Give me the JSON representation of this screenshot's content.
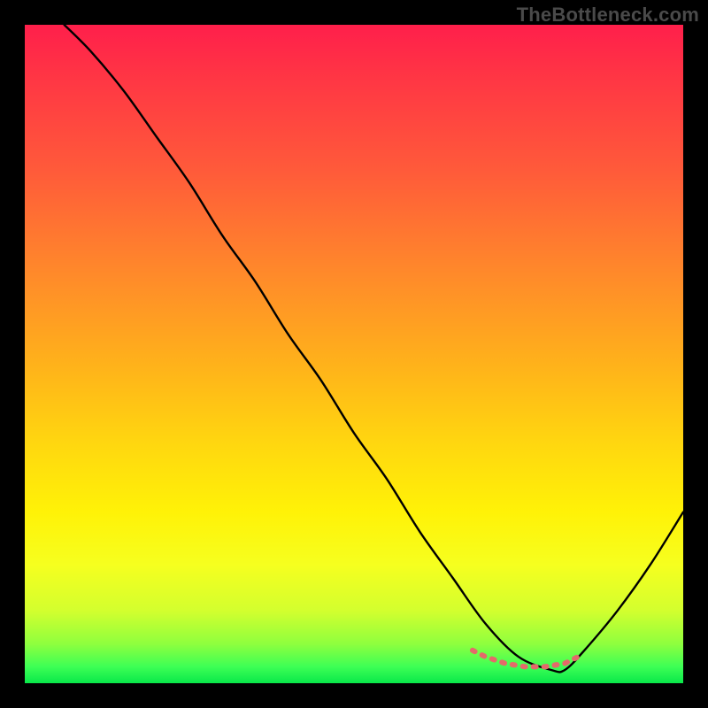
{
  "watermark": "TheBottleneck.com",
  "chart_data": {
    "type": "line",
    "title": "",
    "xlabel": "",
    "ylabel": "",
    "xlim": [
      0,
      100
    ],
    "ylim": [
      0,
      100
    ],
    "grid": false,
    "legend": false,
    "annotations": [],
    "notes": "Background is a vertical heat gradient (red at top through orange/yellow to green at bottom). A single black curve descends from top-left, reaches a flat trough near the bottom around x≈70–82, then rises toward the right. A short coral/dotted segment highlights the trough. Values estimated from pixel positions since no axes or ticks are drawn.",
    "series": [
      {
        "name": "main-curve",
        "color": "#000000",
        "x": [
          6,
          10,
          15,
          20,
          25,
          30,
          35,
          40,
          45,
          50,
          55,
          60,
          65,
          70,
          75,
          80,
          82,
          85,
          90,
          95,
          100
        ],
        "values": [
          100,
          96,
          90,
          83,
          76,
          68,
          61,
          53,
          46,
          38,
          31,
          23,
          16,
          9,
          4,
          2,
          2,
          5,
          11,
          18,
          26
        ]
      },
      {
        "name": "trough-highlight",
        "color": "#e46a6a",
        "style": "dotted",
        "x": [
          68,
          70,
          73,
          76,
          79,
          82,
          84
        ],
        "values": [
          5,
          4,
          3,
          2.5,
          2.5,
          3,
          4
        ]
      }
    ],
    "gradient_stops": [
      {
        "pos": 0,
        "color": "#ff1f4b"
      },
      {
        "pos": 0.22,
        "color": "#ff5a3a"
      },
      {
        "pos": 0.52,
        "color": "#ffb31a"
      },
      {
        "pos": 0.74,
        "color": "#fff207"
      },
      {
        "pos": 0.94,
        "color": "#8fff3e"
      },
      {
        "pos": 1.0,
        "color": "#09e84a"
      }
    ]
  }
}
